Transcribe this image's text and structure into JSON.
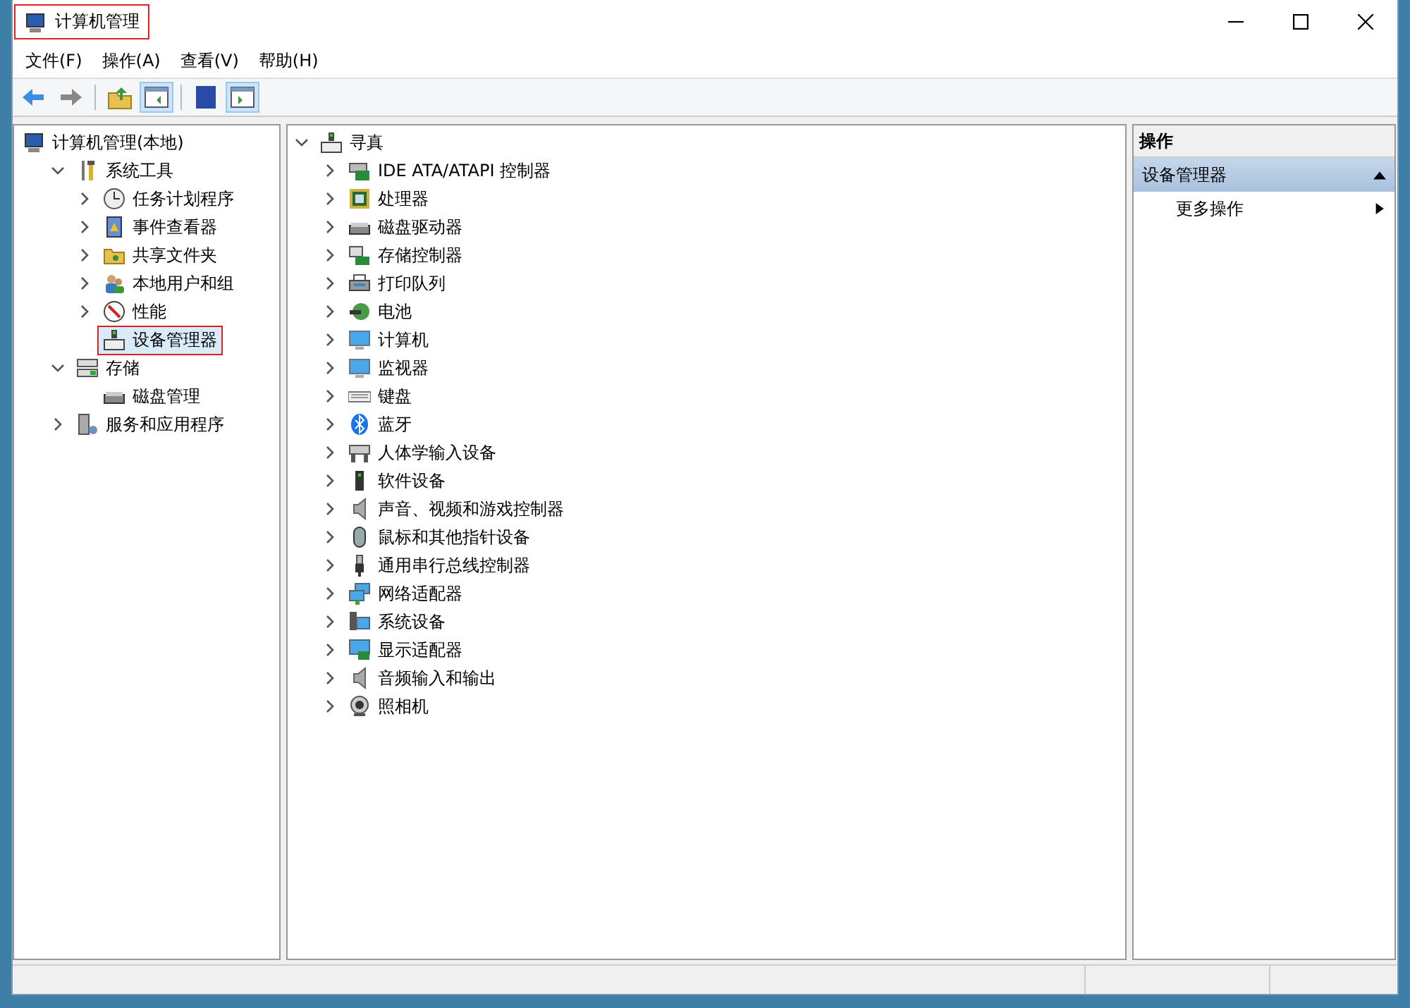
{
  "window": {
    "title": "计算机管理",
    "title_marked": true
  },
  "menu": [
    "文件(F)",
    "操作(A)",
    "查看(V)",
    "帮助(H)"
  ],
  "toolbar": [
    {
      "kind": "back",
      "pressed": false
    },
    {
      "kind": "forward",
      "pressed": false
    },
    {
      "kind": "sep"
    },
    {
      "kind": "up",
      "pressed": false
    },
    {
      "kind": "tree",
      "pressed": true
    },
    {
      "kind": "sep"
    },
    {
      "kind": "help",
      "pressed": false
    },
    {
      "kind": "pane",
      "pressed": true
    }
  ],
  "nav_tree": [
    {
      "label": "计算机管理(本地)",
      "selected": false,
      "marked": false,
      "children": [
        {
          "label": "系统工具",
          "expanded": true,
          "selected": false,
          "marked": false,
          "children": [
            {
              "label": "任务计划程序",
              "expanded": false,
              "selected": false,
              "marked": false
            },
            {
              "label": "事件查看器",
              "expanded": false,
              "selected": false,
              "marked": false
            },
            {
              "label": "共享文件夹",
              "expanded": false,
              "selected": false,
              "marked": false
            },
            {
              "label": "本地用户和组",
              "expanded": false,
              "selected": false,
              "marked": false
            },
            {
              "label": "性能",
              "expanded": false,
              "selected": false,
              "marked": false
            },
            {
              "label": "设备管理器",
              "selected": true,
              "marked": true
            }
          ]
        },
        {
          "label": "存储",
          "expanded": true,
          "selected": false,
          "marked": false,
          "children": [
            {
              "label": "磁盘管理",
              "selected": false,
              "marked": false
            }
          ]
        },
        {
          "label": "服务和应用程序",
          "expanded": false,
          "selected": false,
          "marked": false
        }
      ]
    }
  ],
  "device_tree": {
    "label": "寻真",
    "expanded": true,
    "children": [
      {
        "label": "IDE ATA/ATAPI 控制器"
      },
      {
        "label": "处理器"
      },
      {
        "label": "磁盘驱动器"
      },
      {
        "label": "存储控制器"
      },
      {
        "label": "打印队列"
      },
      {
        "label": "电池"
      },
      {
        "label": "计算机"
      },
      {
        "label": "监视器"
      },
      {
        "label": "键盘"
      },
      {
        "label": "蓝牙"
      },
      {
        "label": "人体学输入设备"
      },
      {
        "label": "软件设备"
      },
      {
        "label": "声音、视频和游戏控制器"
      },
      {
        "label": "鼠标和其他指针设备"
      },
      {
        "label": "通用串行总线控制器"
      },
      {
        "label": "网络适配器"
      },
      {
        "label": "系统设备"
      },
      {
        "label": "显示适配器"
      },
      {
        "label": "音频输入和输出"
      },
      {
        "label": "照相机"
      }
    ]
  },
  "actions": {
    "header": "操作",
    "sections": [
      {
        "title": "设备管理器",
        "expanded": true,
        "items": [
          "更多操作"
        ]
      }
    ]
  }
}
